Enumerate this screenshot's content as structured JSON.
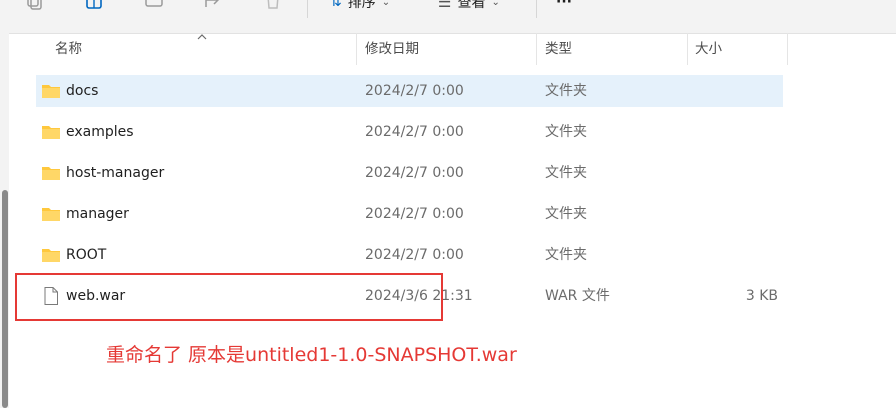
{
  "toolbar": {
    "sort_label": "排序",
    "view_label": "查看",
    "more_label": "···"
  },
  "columns": {
    "name": "名称",
    "date": "修改日期",
    "type": "类型",
    "size": "大小"
  },
  "files": [
    {
      "icon": "folder-icon",
      "name": "docs",
      "date": "2024/2/7 0:00",
      "type": "文件夹",
      "size": "",
      "selected": true
    },
    {
      "icon": "folder-icon",
      "name": "examples",
      "date": "2024/2/7 0:00",
      "type": "文件夹",
      "size": "",
      "selected": false
    },
    {
      "icon": "folder-icon",
      "name": "host-manager",
      "date": "2024/2/7 0:00",
      "type": "文件夹",
      "size": "",
      "selected": false
    },
    {
      "icon": "folder-icon",
      "name": "manager",
      "date": "2024/2/7 0:00",
      "type": "文件夹",
      "size": "",
      "selected": false
    },
    {
      "icon": "folder-icon",
      "name": "ROOT",
      "date": "2024/2/7 0:00",
      "type": "文件夹",
      "size": "",
      "selected": false
    },
    {
      "icon": "file-icon",
      "name": "web.war",
      "date": "2024/3/6 21:31",
      "type": "WAR 文件",
      "size": "3 KB",
      "selected": false
    }
  ],
  "annotation": {
    "text": "重命名了 原本是untitled1-1.0-SNAPSHOT.war",
    "color": "#e53935"
  },
  "colors": {
    "selected_row": "#e5f1fb",
    "folder": "#ffc83d",
    "accent": "#0067c0"
  }
}
